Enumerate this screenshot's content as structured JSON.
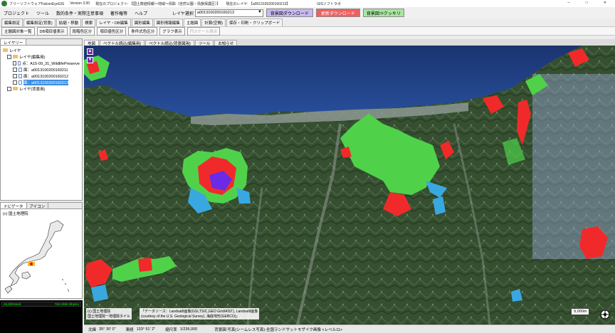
{
  "titlebar": {
    "app_name": "フリーソフトウェアFalconEyeGIS",
    "version": "Version 3.00",
    "project": "現在のプロジェクト: 【国土数値情報～地域～鳥取（自然公園・鳥獣保護区）】",
    "current_layer": "現在のレイヤ: 【a0013100200160213】",
    "vendor": "GISソフトラボ",
    "minimize": "─",
    "maximize": "□",
    "close": "✕"
  },
  "menu": {
    "items": [
      "プロジェクト",
      "ツール",
      "数的条件・実際注意事項",
      "著作権等",
      "ヘルプ"
    ],
    "layer_select_label": "レイヤ選択",
    "layer_select_value": "a0013100200160213",
    "layer_select_arrow": "▼",
    "btn_bg_download": "背景図ダウンロード",
    "btn_update_download": "更新ダウンロード",
    "btn_bg_clip": "背景図⇒クッキリ",
    "colors": {
      "bg_download": "#c9b8f0",
      "update_download": "#f06060",
      "bg_clip": "#a8e6a0"
    }
  },
  "tooltabs": {
    "tabs": [
      "編集設定",
      "編集設定(背景)",
      "拡縮・移動",
      "検索",
      "レイヤ・DB編集",
      "図形編集",
      "図形情報編集",
      "主題図",
      "計算(空間)",
      "保存・印刷・クリップボード"
    ],
    "active_index": 7
  },
  "toolrow": {
    "buttons": [
      "主題図対象一覧",
      "DB項目値表示",
      "段階色区分",
      "項目値色区分",
      "条件式色区分",
      "グラフ表示",
      "円スケール表示"
    ],
    "disabled_index": 6
  },
  "layerpanel": {
    "tab": "レイヤリー",
    "root": "レイヤ",
    "group_edit": "レイヤ(編集用)",
    "layers": [
      "点：A15-09_31_WildlifePreserve",
      "面：a0013100200160211",
      "面：a0013100200160212",
      "面：a0013100200160213"
    ],
    "selected_index": 3,
    "group_bg": "レイヤ(背景用)"
  },
  "navpanel": {
    "tabs": [
      "ナビゲータ",
      "アイコン"
    ],
    "credit": "(c) 国土地理院"
  },
  "status": {
    "left": "26,600Used",
    "right": "760,336K Bbytes"
  },
  "maptabs": {
    "tabs": [
      "地図",
      "ベクトル読込(編集用)",
      "ベクトル読込(背景図用)",
      "ツール",
      "お知らせ"
    ],
    "active_index": 0
  },
  "map": {
    "credit_1": "(c) 国土地理院",
    "credit_2": "国土地理院ー地理院タイル",
    "data_source_1": "「データソース：Landsat8画像(GSI,TSIC,GEO Grid/AIST), Landsat8画像",
    "data_source_2": "(courtesy of the U.S. Geological Survey), 海底地形(GEBCO)」",
    "scale": "9,000m",
    "compass_icon": "compass-icon",
    "nav_buttons": [
      "▲",
      "▼"
    ],
    "colors": {
      "sea": "#1e3c7a",
      "land_dark": "#2f4a2c",
      "land_light": "#5f7a58",
      "urban": "#9aa4a0",
      "green_zone": "#4fd24a",
      "red_zone": "#f02a2a",
      "blue_zone": "#3aa8e0",
      "purple_zone": "#6a2ae6"
    }
  },
  "coords": {
    "lat_label": "北緯",
    "lat": "35° 30' 0\"",
    "lon_label": "東経",
    "lon": "133° 51' 2\"",
    "scale_label": "縮尺率",
    "scale": "1/236,000",
    "background": "背景図:写真(シームレス写真)-全国ランドサットモザイク画像 <レベル11>"
  }
}
